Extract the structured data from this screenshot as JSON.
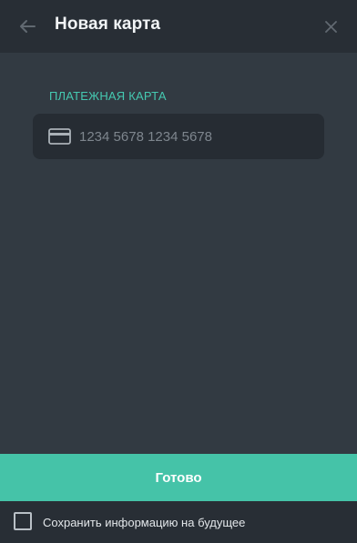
{
  "header": {
    "title": "Новая карта",
    "back_icon": "arrow-left-icon",
    "close_icon": "close-icon"
  },
  "card_field": {
    "label": "ПЛАТЕЖНАЯ КАРТА",
    "placeholder": "1234 5678 1234 5678",
    "value": "",
    "icon": "credit-card-icon"
  },
  "actions": {
    "submit_label": "Готово"
  },
  "footer": {
    "save_label": "Сохранить информацию на будущее",
    "save_checked": false
  },
  "colors": {
    "background": "#323a42",
    "header": "#282e35",
    "accent": "#45c3a8",
    "label": "#45c9b1",
    "input_bg": "#262c33"
  }
}
